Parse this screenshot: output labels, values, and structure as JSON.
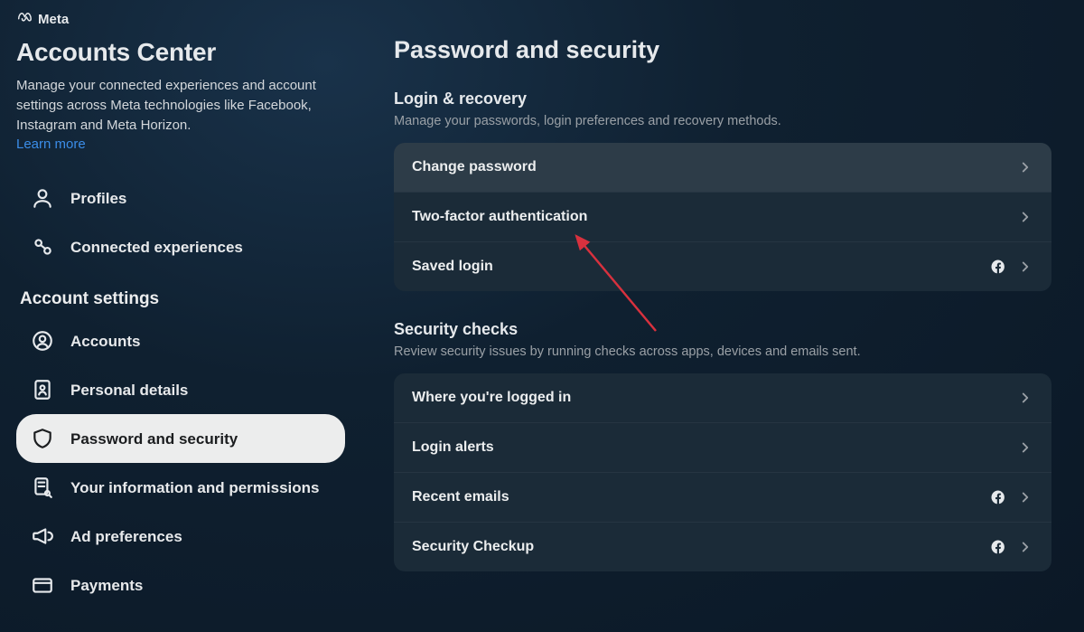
{
  "brand": {
    "name": "Meta"
  },
  "sidebar": {
    "title": "Accounts Center",
    "description": "Manage your connected experiences and account settings across Meta technologies like Facebook, Instagram and Meta Horizon.",
    "learn_more": "Learn more",
    "top_items": [
      {
        "label": "Profiles"
      },
      {
        "label": "Connected experiences"
      }
    ],
    "settings_heading": "Account settings",
    "settings_items": [
      {
        "label": "Accounts"
      },
      {
        "label": "Personal details"
      },
      {
        "label": "Password and security"
      },
      {
        "label": "Your information and permissions"
      },
      {
        "label": "Ad preferences"
      },
      {
        "label": "Payments"
      }
    ]
  },
  "main": {
    "title": "Password and security",
    "groups": [
      {
        "title": "Login & recovery",
        "description": "Manage your passwords, login preferences and recovery methods.",
        "rows": [
          {
            "label": "Change password",
            "fb": false,
            "hover": true
          },
          {
            "label": "Two-factor authentication",
            "fb": false,
            "hover": false
          },
          {
            "label": "Saved login",
            "fb": true,
            "hover": false
          }
        ]
      },
      {
        "title": "Security checks",
        "description": "Review security issues by running checks across apps, devices and emails sent.",
        "rows": [
          {
            "label": "Where you're logged in",
            "fb": false,
            "hover": false
          },
          {
            "label": "Login alerts",
            "fb": false,
            "hover": false
          },
          {
            "label": "Recent emails",
            "fb": true,
            "hover": false
          },
          {
            "label": "Security Checkup",
            "fb": true,
            "hover": false
          }
        ]
      }
    ]
  }
}
